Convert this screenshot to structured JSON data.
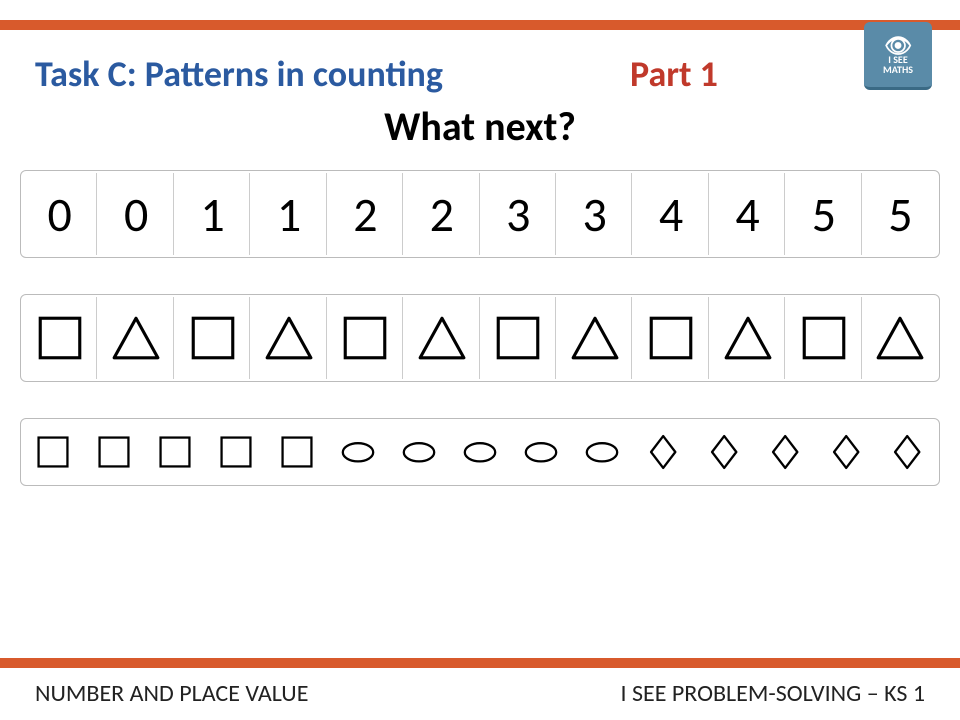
{
  "task_title": "Task C: Patterns in counting",
  "part_label": "Part 1",
  "question": "What next?",
  "logo": {
    "line1": "I SEE",
    "line2": "MATHS"
  },
  "row_numbers": [
    "0",
    "0",
    "1",
    "1",
    "2",
    "2",
    "3",
    "3",
    "4",
    "4",
    "5",
    "5"
  ],
  "row_shapes": [
    "square",
    "triangle",
    "square",
    "triangle",
    "square",
    "triangle",
    "square",
    "triangle",
    "square",
    "triangle",
    "square",
    "triangle"
  ],
  "row_mixed": [
    "square",
    "square",
    "square",
    "square",
    "square",
    "oval",
    "oval",
    "oval",
    "oval",
    "oval",
    "diamond",
    "diamond",
    "diamond",
    "diamond",
    "diamond"
  ],
  "footer_left": "NUMBER AND PLACE VALUE",
  "footer_right": "I SEE PROBLEM-SOLVING – KS 1"
}
